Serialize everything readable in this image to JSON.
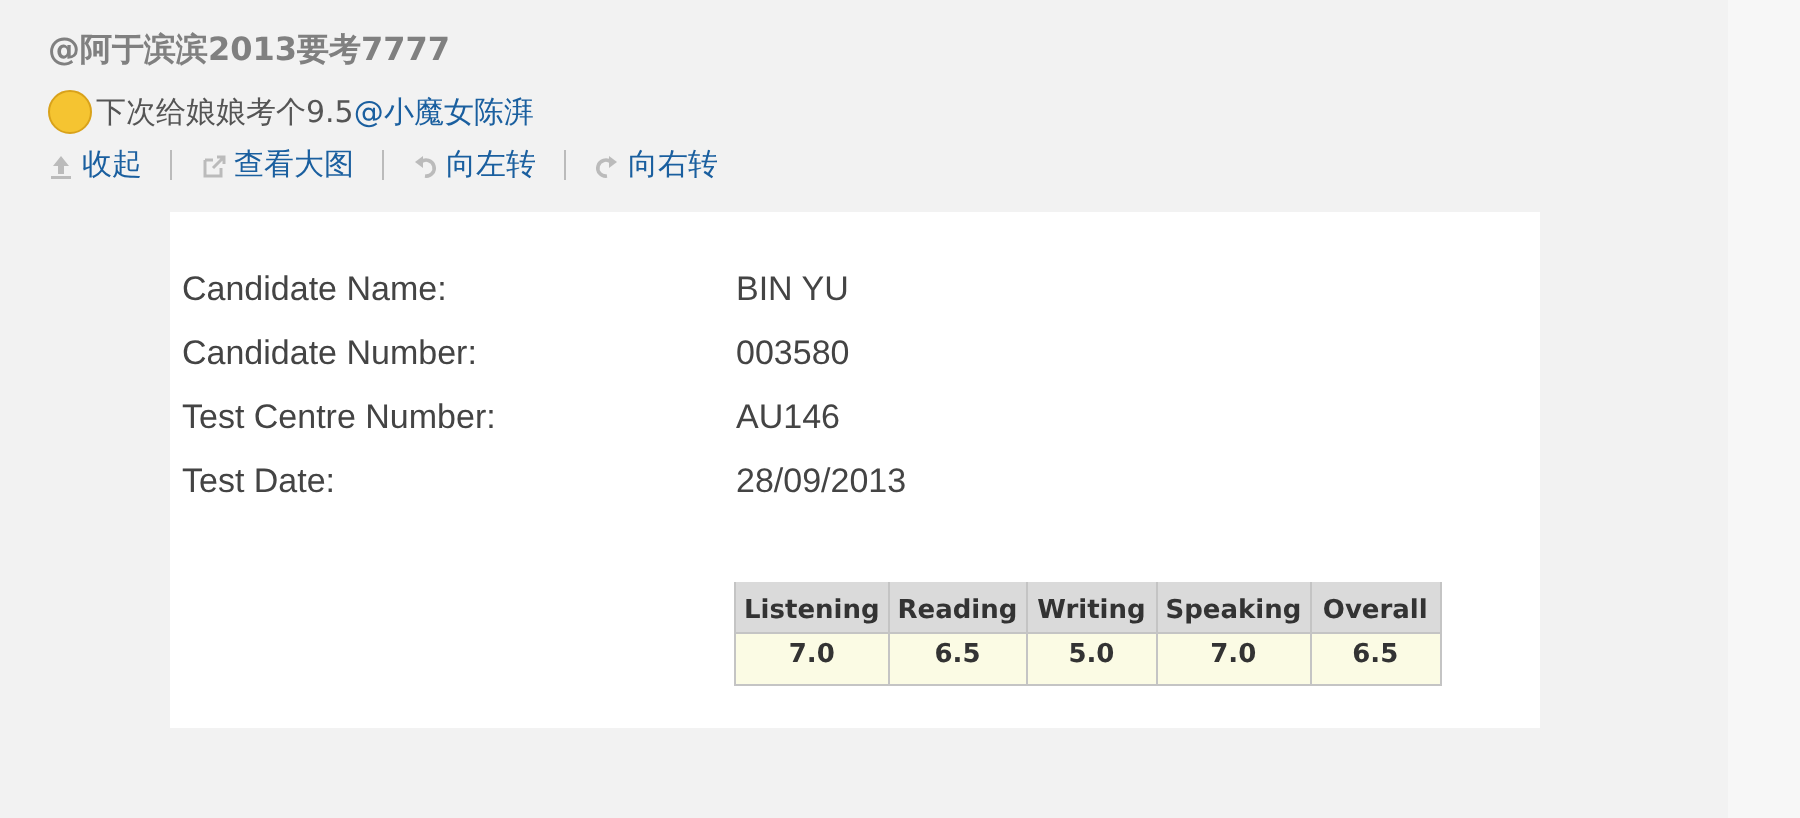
{
  "post": {
    "author": "@阿于滨滨2013要考7777",
    "text": "下次给娘娘考个9.5",
    "mention": "@小魔女陈湃",
    "actions": [
      {
        "kind": "collapse",
        "label": "收起"
      },
      {
        "kind": "open",
        "label": "查看大图"
      },
      {
        "kind": "left",
        "label": "向左转"
      },
      {
        "kind": "right",
        "label": "向右转"
      }
    ]
  },
  "document": {
    "fields": [
      {
        "label": "Candidate Name:",
        "value": "BIN YU"
      },
      {
        "label": "Candidate Number:",
        "value": "003580"
      },
      {
        "label": "Test Centre Number:",
        "value": "AU146"
      },
      {
        "label": "Test Date:",
        "value": "28/09/2013"
      }
    ],
    "scores": {
      "columns": [
        "Listening",
        "Reading",
        "Writing",
        "Speaking",
        "Overall"
      ],
      "values": [
        "7.0",
        "6.5",
        "5.0",
        "7.0",
        "6.5"
      ]
    }
  }
}
